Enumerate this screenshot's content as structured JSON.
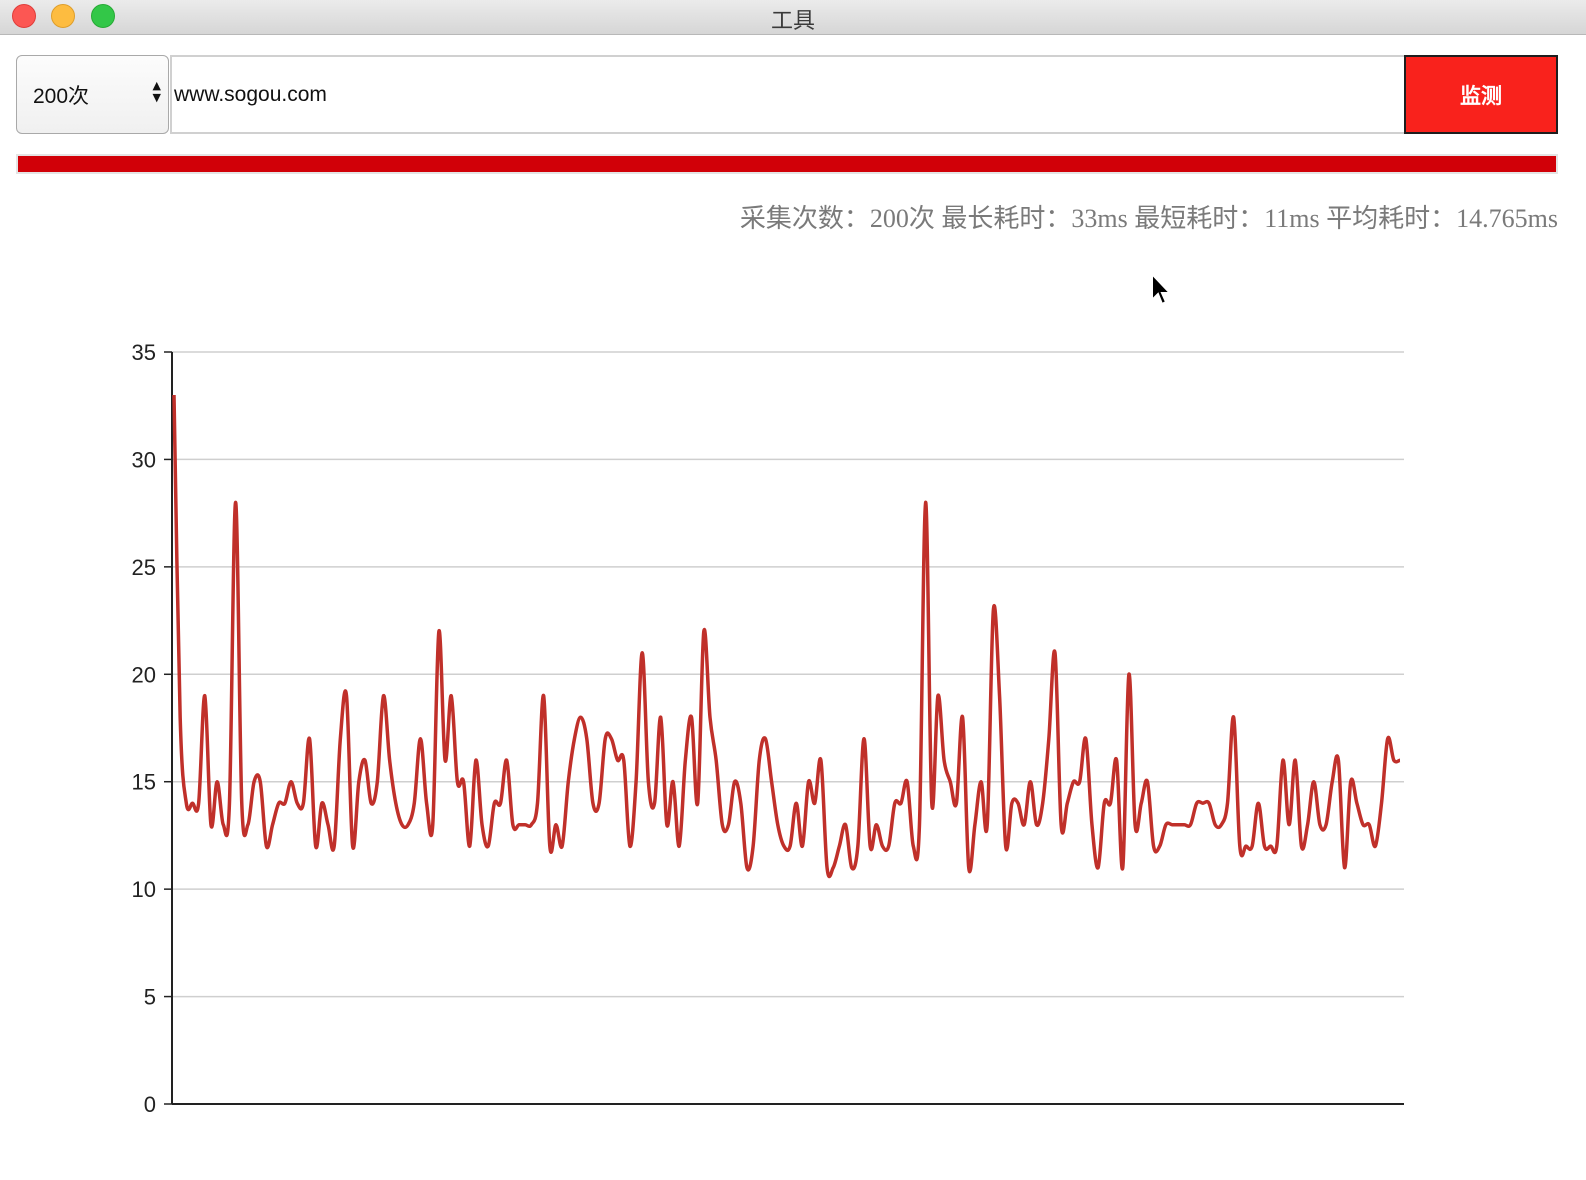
{
  "window": {
    "title": "工具",
    "colors": {
      "close": "#fc5753",
      "minimize": "#fdbc40",
      "maximize": "#33c748"
    }
  },
  "toolbar": {
    "count_select": {
      "value": "200次"
    },
    "url_input": {
      "value": "www.sogou.com"
    },
    "monitor_button": {
      "label": "监测",
      "color": "#f9221c"
    }
  },
  "progress": {
    "value": 1.0,
    "color": "#d10008"
  },
  "stats": {
    "count": "采集次数：200次",
    "max": "最长耗时：33ms",
    "min": "最短耗时：11ms",
    "avg": "平均耗时：14.765ms"
  },
  "chart_data": {
    "type": "line",
    "title": "",
    "xlabel": "",
    "ylabel": "",
    "ylim": [
      0,
      35
    ],
    "yticks": [
      "0",
      "5",
      "10",
      "15",
      "20",
      "25",
      "30",
      "35"
    ],
    "grid": true,
    "line_color": "#c0302a",
    "x": [
      1,
      2,
      3,
      4,
      5,
      6,
      7,
      8,
      9,
      10,
      11,
      12,
      13,
      14,
      15,
      16,
      17,
      18,
      19,
      20,
      21,
      22,
      23,
      24,
      25,
      26,
      27,
      28,
      29,
      30,
      31,
      32,
      33,
      34,
      35,
      36,
      37,
      38,
      39,
      40,
      41,
      42,
      43,
      44,
      45,
      46,
      47,
      48,
      49,
      50,
      51,
      52,
      53,
      54,
      55,
      56,
      57,
      58,
      59,
      60,
      61,
      62,
      63,
      64,
      65,
      66,
      67,
      68,
      69,
      70,
      71,
      72,
      73,
      74,
      75,
      76,
      77,
      78,
      79,
      80,
      81,
      82,
      83,
      84,
      85,
      86,
      87,
      88,
      89,
      90,
      91,
      92,
      93,
      94,
      95,
      96,
      97,
      98,
      99,
      100,
      101,
      102,
      103,
      104,
      105,
      106,
      107,
      108,
      109,
      110,
      111,
      112,
      113,
      114,
      115,
      116,
      117,
      118,
      119,
      120,
      121,
      122,
      123,
      124,
      125,
      126,
      127,
      128,
      129,
      130,
      131,
      132,
      133,
      134,
      135,
      136,
      137,
      138,
      139,
      140,
      141,
      142,
      143,
      144,
      145,
      146,
      147,
      148,
      149,
      150,
      151,
      152,
      153,
      154,
      155,
      156,
      157,
      158,
      159,
      160,
      161,
      162,
      163,
      164,
      165,
      166,
      167,
      168,
      169,
      170,
      171,
      172,
      173,
      174,
      175,
      176,
      177,
      178,
      179,
      180,
      181,
      182,
      183,
      184,
      185,
      186,
      187,
      188,
      189,
      190,
      191,
      192,
      193,
      194,
      195,
      196,
      197,
      198,
      199,
      200
    ],
    "values": [
      33,
      18,
      14,
      14,
      14,
      19,
      13,
      15,
      13,
      14,
      28,
      14,
      13,
      15,
      15,
      12,
      13,
      14,
      14,
      15,
      14,
      14,
      17,
      12,
      14,
      13,
      12,
      17,
      19,
      12,
      15,
      16,
      14,
      15,
      19,
      16,
      14,
      13,
      13,
      14,
      17,
      14,
      13,
      22,
      16,
      19,
      15,
      15,
      12,
      16,
      13,
      12,
      14,
      14,
      16,
      13,
      13,
      13,
      13,
      14,
      19,
      12,
      13,
      12,
      15,
      17,
      18,
      17,
      14,
      14,
      17,
      17,
      16,
      16,
      12,
      15,
      21,
      15,
      14,
      18,
      13,
      15,
      12,
      16,
      18,
      14,
      22,
      18,
      16,
      13,
      13,
      15,
      14,
      11,
      12,
      16,
      17,
      15,
      13,
      12,
      12,
      14,
      12,
      15,
      14,
      16,
      11,
      11,
      12,
      13,
      11,
      12,
      17,
      12,
      13,
      12,
      12,
      14,
      14,
      15,
      12,
      13,
      28,
      14,
      19,
      16,
      15,
      14,
      18,
      11,
      13,
      15,
      13,
      23,
      19,
      12,
      14,
      14,
      13,
      15,
      13,
      14,
      17,
      21,
      13,
      14,
      15,
      15,
      17,
      13,
      11,
      14,
      14,
      16,
      11,
      20,
      13,
      14,
      15,
      12,
      12,
      13,
      13,
      13,
      13,
      13,
      14,
      14,
      14,
      13,
      13,
      14,
      18,
      12,
      12,
      12,
      14,
      12,
      12,
      12,
      16,
      13,
      16,
      12,
      13,
      15,
      13,
      13,
      15,
      16,
      11,
      15,
      14,
      13,
      13,
      12,
      14,
      17,
      16,
      16
    ],
    "max": 33,
    "min": 11,
    "avg": 14.765
  }
}
